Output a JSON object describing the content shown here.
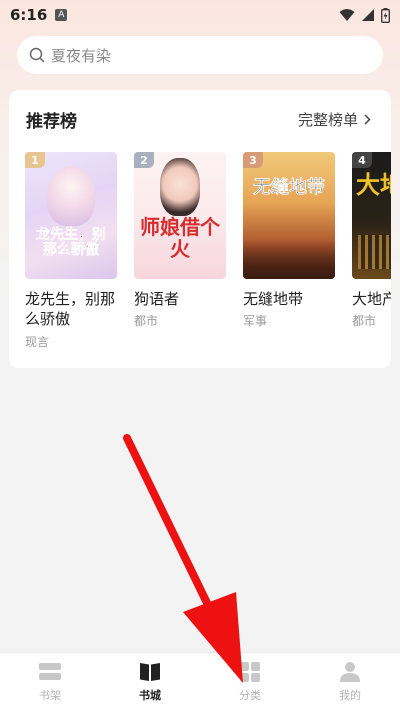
{
  "status_bar": {
    "time": "6:16",
    "badge": "A"
  },
  "search": {
    "placeholder": "夏夜有染"
  },
  "ranking": {
    "title": "推荐榜",
    "more_label": "完整榜单",
    "books": [
      {
        "rank": "1",
        "name": "龙先生，别那么骄傲",
        "category": "现言",
        "cover_title": "龙先生，别那么骄傲",
        "badge_color": "#e8c48e"
      },
      {
        "rank": "2",
        "name": "狗语者",
        "category": "都市",
        "cover_title": "师娘借个火",
        "badge_color": "#a8b1bd"
      },
      {
        "rank": "3",
        "name": "无缝地带",
        "category": "军事",
        "cover_title": "无缝地带",
        "badge_color": "#d79b78"
      },
      {
        "rank": "4",
        "name": "大地产",
        "category": "都市",
        "cover_title": "大地",
        "badge_color": "#444444"
      }
    ]
  },
  "tabs": [
    {
      "label": "书架",
      "icon": "bookshelf-icon",
      "active": false
    },
    {
      "label": "书城",
      "icon": "book-open-icon",
      "active": true
    },
    {
      "label": "分类",
      "icon": "category-grid-icon",
      "active": false
    },
    {
      "label": "我的",
      "icon": "person-icon",
      "active": false
    }
  ],
  "colors": {
    "accent_text": "#222222",
    "inactive_tab": "#b3b3b3",
    "arrow": "#ee1111"
  }
}
